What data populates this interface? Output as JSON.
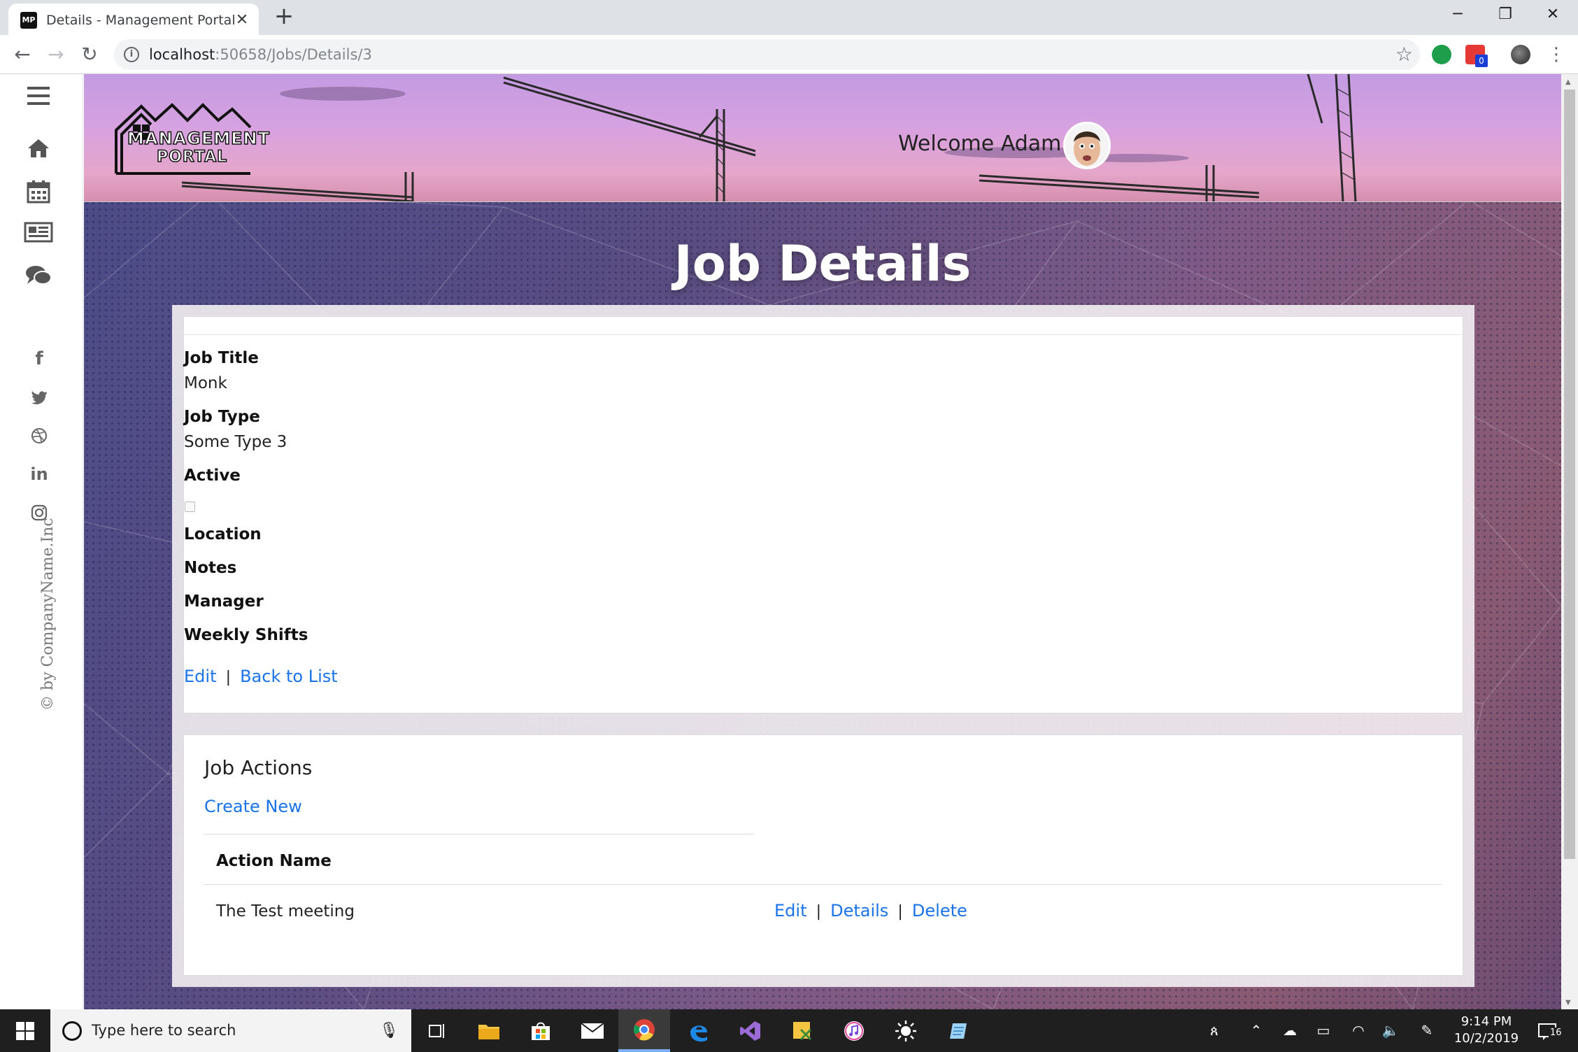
{
  "browser": {
    "tab_title": "Details - Management Portal",
    "favicon_text": "MP",
    "url_host": "localhost",
    "url_rest": ":50658/Jobs/Details/3",
    "extension_badge": "0"
  },
  "sidebar": {
    "icons": [
      "menu-icon",
      "home-icon",
      "calendar-icon",
      "newspaper-icon",
      "comments-icon"
    ],
    "social": [
      "facebook-icon",
      "twitter-icon",
      "dribbble-icon",
      "linkedin-icon",
      "instagram-icon"
    ],
    "copyright": "© by CompanyName.Inc"
  },
  "banner": {
    "logo_line1": "MANAGEMENT",
    "logo_line2": "PORTAL",
    "welcome": "Welcome Adam I"
  },
  "page": {
    "title": "Job Details"
  },
  "details": {
    "job_title_label": "Job Title",
    "job_title_value": "Monk",
    "job_type_label": "Job Type",
    "job_type_value": "Some Type 3",
    "active_label": "Active",
    "active_value": false,
    "location_label": "Location",
    "notes_label": "Notes",
    "manager_label": "Manager",
    "weekly_shifts_label": "Weekly Shifts",
    "edit_link": "Edit",
    "separator": "|",
    "back_link": "Back to List"
  },
  "actions": {
    "title": "Job Actions",
    "create_link": "Create New",
    "column_header": "Action Name",
    "rows": [
      {
        "name": "The Test meeting",
        "edit": "Edit",
        "details": "Details",
        "delete": "Delete"
      }
    ]
  },
  "taskbar": {
    "search_placeholder": "Type here to search",
    "time": "9:14 PM",
    "date": "10/2/2019",
    "notification_count": "16"
  }
}
